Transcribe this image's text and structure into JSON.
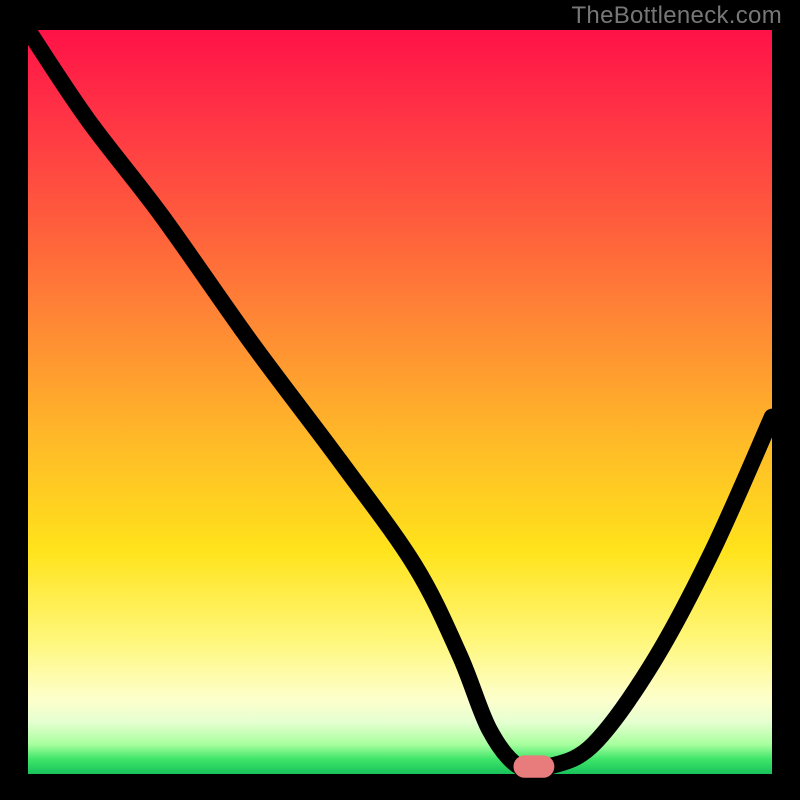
{
  "watermark": "TheBottleneck.com",
  "chart_data": {
    "type": "line",
    "title": "",
    "xlabel": "",
    "ylabel": "",
    "xlim": [
      0,
      100
    ],
    "ylim": [
      0,
      100
    ],
    "grid": false,
    "legend": false,
    "series": [
      {
        "name": "bottleneck-curve",
        "x": [
          0,
          8,
          18,
          30,
          42,
          52,
          58,
          62,
          66,
          70,
          76,
          84,
          92,
          100
        ],
        "y": [
          100,
          88,
          75,
          58,
          42,
          28,
          16,
          6,
          1,
          1,
          4,
          15,
          30,
          48
        ]
      }
    ],
    "marker": {
      "x": 68,
      "y": 1,
      "shape": "pill",
      "color": "#e87b7b"
    },
    "gradient_direction": "vertical",
    "gradient_meaning": "top=red (bad) → bottom=green (good)"
  }
}
